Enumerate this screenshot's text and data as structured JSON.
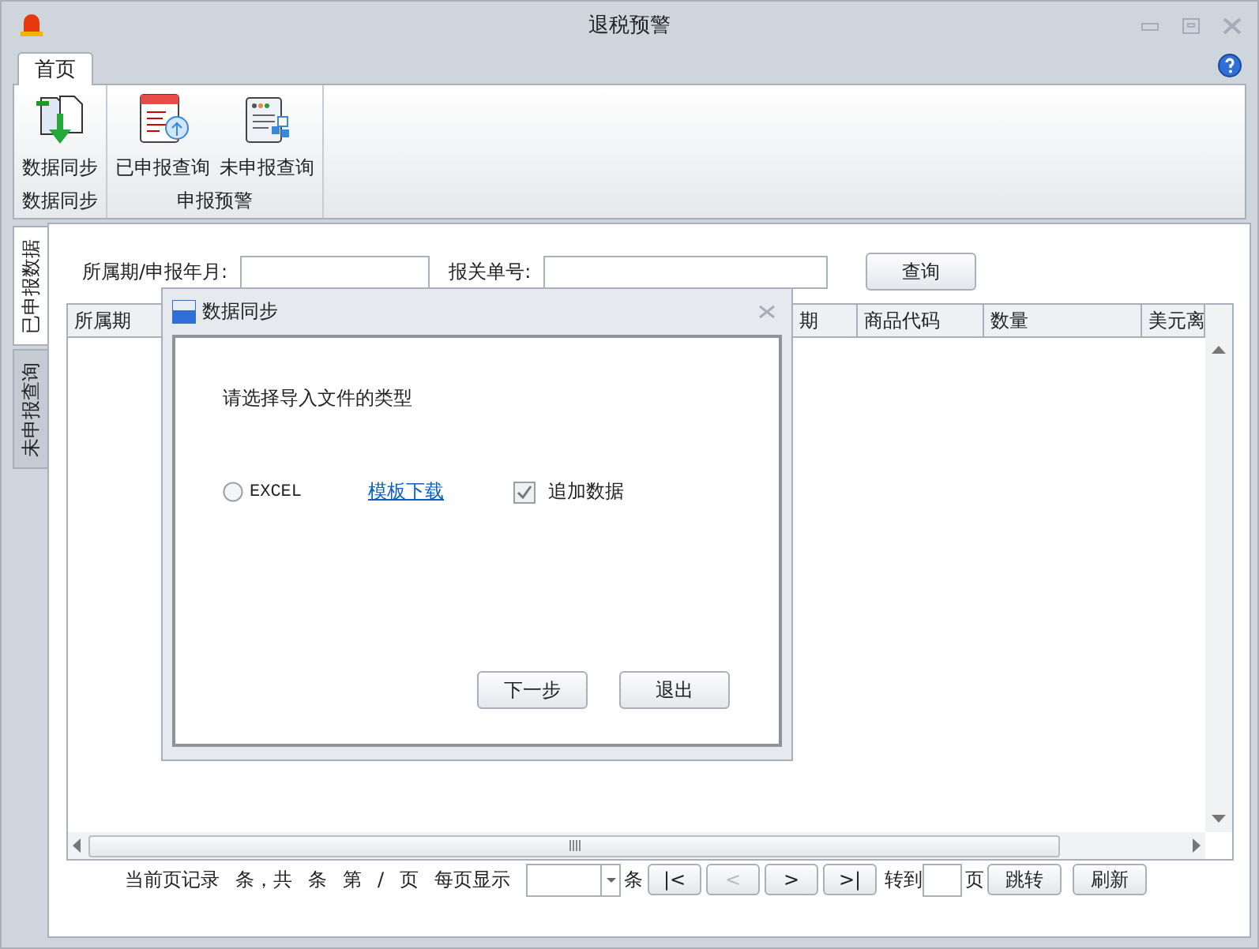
{
  "window": {
    "title": "退税预警"
  },
  "tabs": [
    {
      "label": "首页",
      "selected": true
    }
  ],
  "ribbon": {
    "groups": [
      {
        "label": "数据同步",
        "buttons": [
          {
            "label": "数据同步",
            "kind": "sync"
          }
        ]
      },
      {
        "label": "申报预警",
        "buttons": [
          {
            "label": "已申报查询",
            "kind": "declared"
          },
          {
            "label": "未申报查询",
            "kind": "undeclared"
          }
        ]
      }
    ]
  },
  "side_tabs": [
    {
      "label": "已申报数据",
      "selected": true
    },
    {
      "label": "未申报查询",
      "selected": false
    }
  ],
  "filters": [
    {
      "label": "所属期/申报年月:"
    },
    {
      "label": "报关单号:"
    }
  ],
  "query_button": "查询",
  "table": {
    "columns": [
      "所属期",
      "期",
      "商品代码",
      "数量",
      "美元离"
    ]
  },
  "pager": {
    "texts": [
      "当前页记录",
      "条，共",
      "条",
      "第",
      "/",
      "页",
      "每页显示"
    ],
    "unit": "条",
    "nav": [
      {
        "label": "|<",
        "disabled": false
      },
      {
        "label": "<",
        "disabled": true
      },
      {
        "label": ">",
        "disabled": false
      },
      {
        "label": ">|",
        "disabled": false
      }
    ],
    "goto_label": "转到",
    "page_unit": "页",
    "buttons": [
      "跳转",
      "刷新"
    ]
  },
  "dialog": {
    "title": "数据同步",
    "prompt": "请选择导入文件的类型",
    "option": {
      "label": "EXCEL",
      "selected": false
    },
    "link": "模板下载",
    "checkbox": {
      "label": "追加数据",
      "checked": true
    },
    "buttons": [
      "下一步",
      "退出"
    ]
  }
}
